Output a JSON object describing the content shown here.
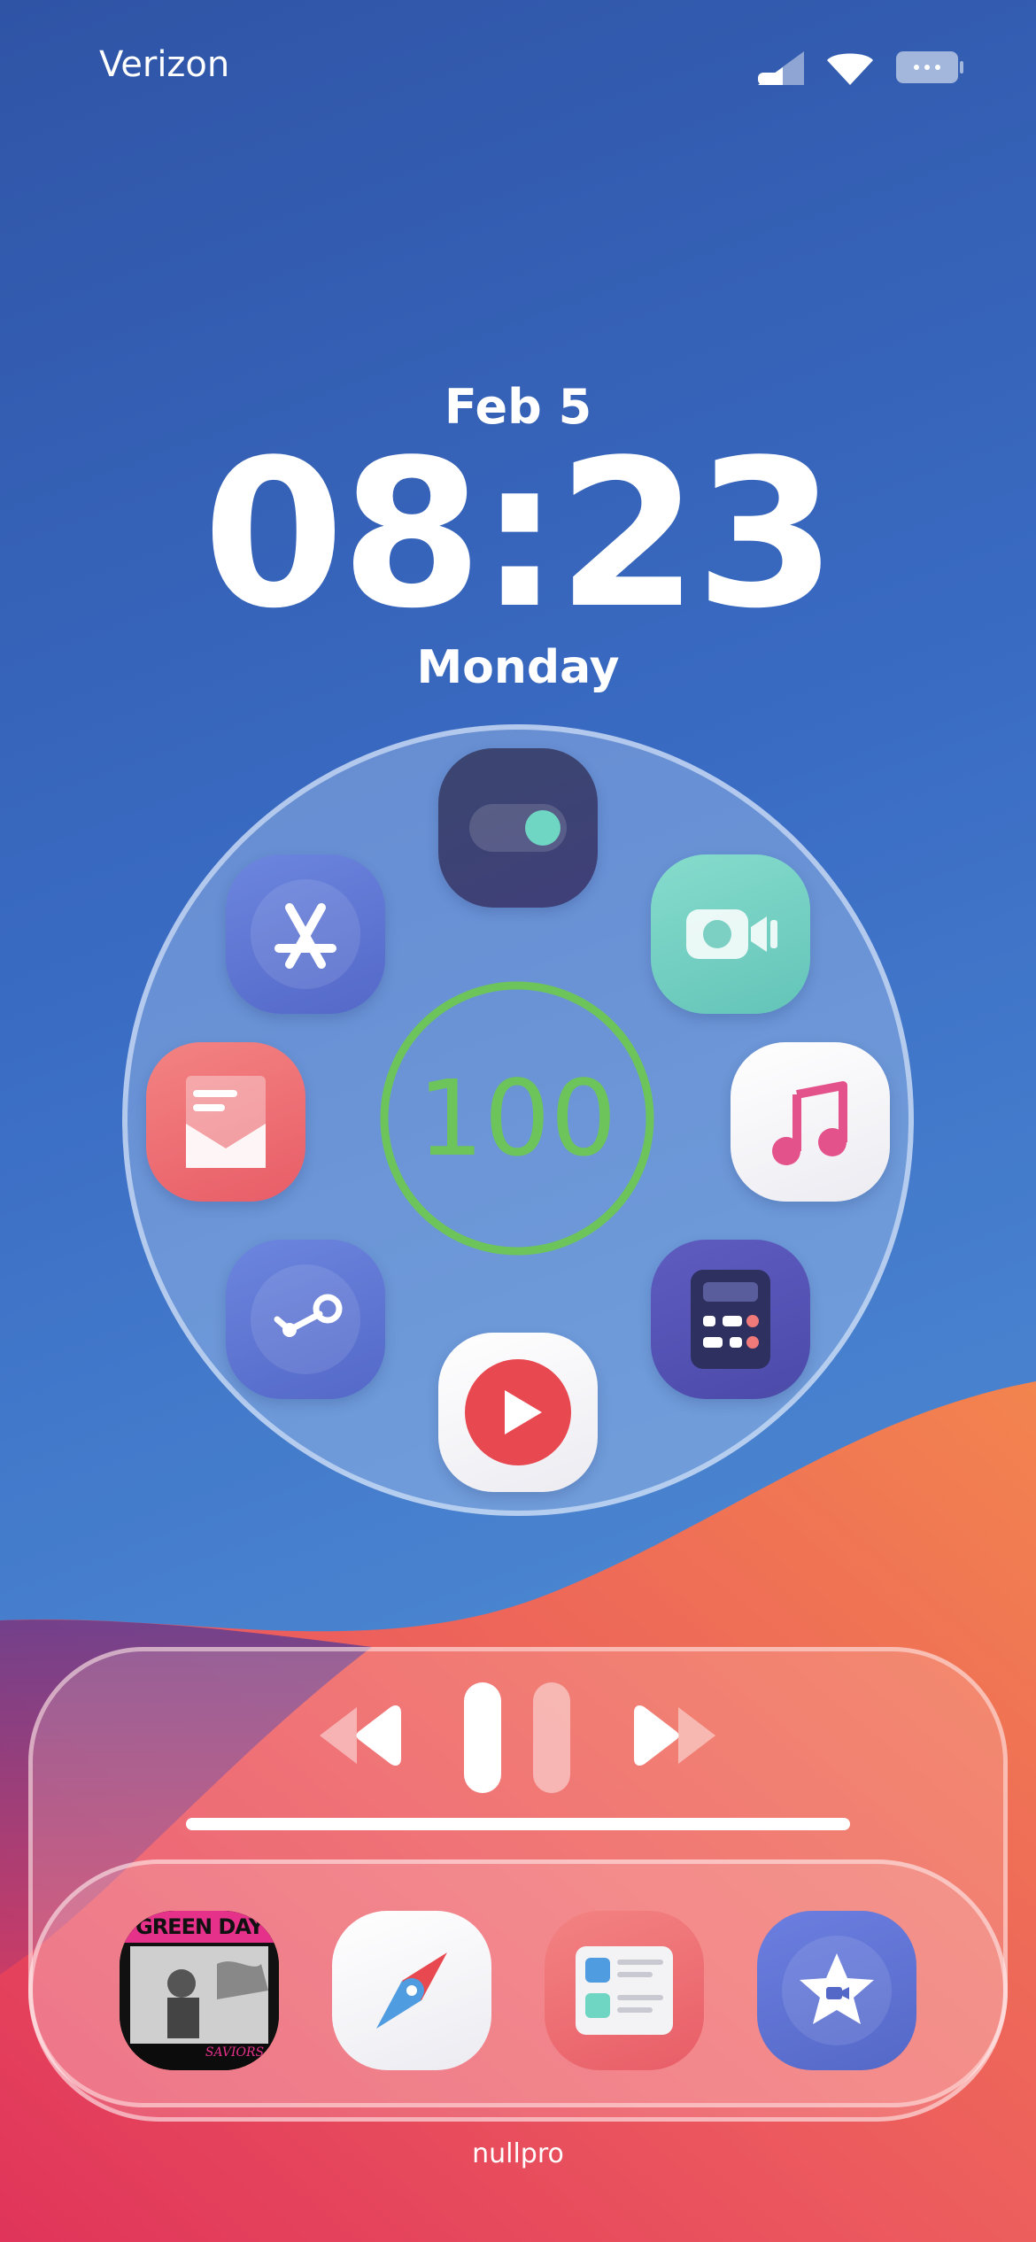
{
  "status_bar": {
    "carrier": "Verizon",
    "icons": [
      "cellular-signal-icon",
      "wifi-icon",
      "battery-icon"
    ]
  },
  "lockscreen": {
    "date": "Feb 5",
    "time": "08:23",
    "day": "Monday"
  },
  "widget": {
    "battery_level": "100",
    "apps": [
      "toggle-app",
      "app-store",
      "facetime",
      "mail",
      "music",
      "steam",
      "calculator",
      "youtube"
    ]
  },
  "player": {
    "controls": [
      "previous",
      "pause",
      "next"
    ],
    "album_art_text": "GREEN DAY",
    "album_art_subtext": "SAVIORS"
  },
  "dock": {
    "apps": [
      "album-art",
      "safari",
      "news",
      "itunes-star"
    ]
  },
  "footer": {
    "author": "nullpro"
  },
  "colors": {
    "battery_ring": "#6cc45a",
    "youtube": "#e8484f",
    "mail": "#f06a6a",
    "facetime": "#7fd6c6"
  }
}
